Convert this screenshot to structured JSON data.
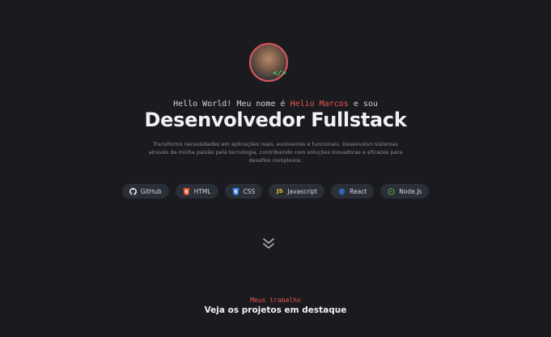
{
  "hero": {
    "avatar_badge": "</>",
    "hello_prefix": "Hello World! Meu nome é ",
    "hello_name": "Helio Marcos",
    "hello_suffix": " e sou",
    "title": "Desenvolvedor Fullstack",
    "description": "Transformo necessidades em aplicações reais, evolventes e funcionais. Desenvolvo sistemas através da minha paixão pela tecnologia, contribuindo com soluções inovadoras e eficazes para desafios complexos."
  },
  "skills": [
    {
      "label": "GitHub",
      "icon": "github-icon",
      "color": "#e6e6ea"
    },
    {
      "label": "HTML",
      "icon": "html5-icon",
      "color": "#e44d26"
    },
    {
      "label": "CSS",
      "icon": "css3-icon",
      "color": "#2f7ce0"
    },
    {
      "label": "Javascript",
      "icon": "js-icon",
      "color": "#f0c419"
    },
    {
      "label": "React",
      "icon": "react-icon",
      "color": "#3b82f6"
    },
    {
      "label": "Node.Js",
      "icon": "nodejs-icon",
      "color": "#5fb83b"
    }
  ],
  "section": {
    "tag": "Meus trabalho",
    "title": "Veja os projetos em destaque"
  },
  "colors": {
    "accent": "#ef5350",
    "background": "#1b1b1f"
  }
}
